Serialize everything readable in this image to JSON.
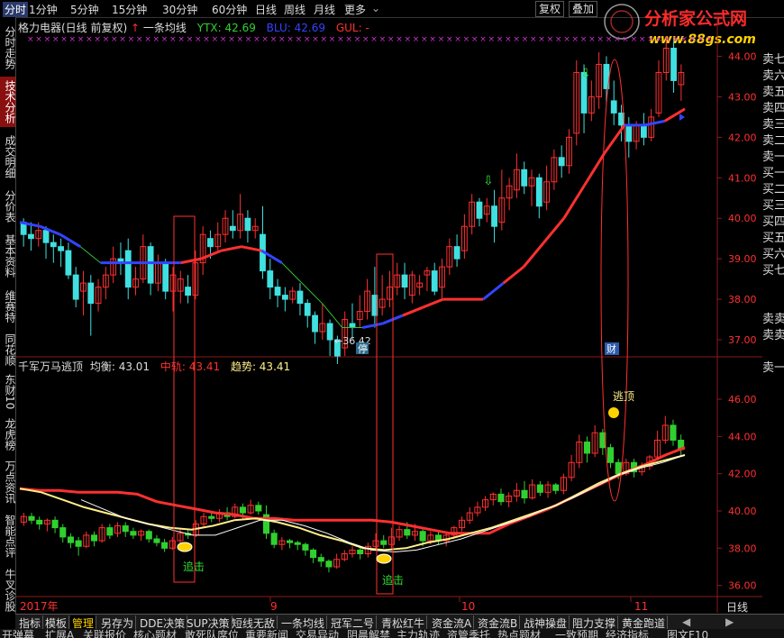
{
  "topbar": {
    "items": [
      "分时",
      "1分钟",
      "5分钟",
      "15分钟",
      "30分钟",
      "60分钟",
      "日线",
      "周线",
      "月线",
      "更多"
    ],
    "restore_btn": "复权",
    "overlay_btn": "叠加"
  },
  "brand": {
    "name": "分析家公式网",
    "url": "www.88gs.com"
  },
  "left_nav": [
    "分时走势",
    "技术分析",
    "成交明细",
    "分价表",
    "基本资料",
    "维赛特",
    "同花顺",
    "东财10",
    "龙虎榜",
    "万点资讯",
    "智能点评",
    "牛叉诊股"
  ],
  "right_nav": [
    "卖七",
    "卖六",
    "卖五",
    "卖四",
    "卖三",
    "卖二",
    "卖一",
    "买一",
    "买二",
    "买三",
    "买四",
    "买五",
    "买六",
    "买七",
    "卖卖",
    "卖卖",
    "卖一"
  ],
  "info_top": {
    "stock": "格力电器(日线 前复权)",
    "indicator": "一条均线",
    "ytx": "YTX: 42.69",
    "blu": "BLU: 42.69",
    "gul": "GUL: -"
  },
  "info_bottom": {
    "indicator": "千军万马逃顶",
    "balance": "均衡: 43.01",
    "middle": "中轨: 43.41",
    "trend": "趋势: 43.41"
  },
  "annotations": {
    "low": "←36.42",
    "stop": "停",
    "cai": "财",
    "escape": "逃顶",
    "chase1": "追击",
    "chase2": "追击"
  },
  "x_labels": [
    "2017年",
    "9",
    "10",
    "11",
    "日线"
  ],
  "bottom_tabs": [
    "指标",
    "模板",
    "管理",
    "另存为",
    "DDE决策",
    "SUP决策",
    "短线无敌",
    "一条均线",
    "冠军二号",
    "青松红牛",
    "资金流A",
    "资金流B",
    "战神操盘",
    "阻力支撑",
    "黄金跑道"
  ],
  "bottom_row2": [
    "开弹幕",
    "扩展A",
    "关联报价",
    "核心题材",
    "敢死队席位",
    "重要新闻",
    "交易异动",
    "阴晨解禁",
    "主力轨迹",
    "资管季托",
    "热点题材",
    "一致预期",
    "经济指标",
    "图文F10"
  ],
  "colors": {
    "up": "#ff3030",
    "down": "#40e0e0",
    "down_lower": "#30d030",
    "blue_line": "#3344ff",
    "green_line": "#33c033",
    "yellow": "#ffee88",
    "white": "#ffffff",
    "grid": "#8a1a1a",
    "axis_text": "#ff3030"
  },
  "chart_data": [
    {
      "type": "candlestick",
      "ylim": [
        36.6,
        44.5
      ],
      "yticks": [
        37.0,
        38.0,
        39.0,
        40.0,
        41.0,
        42.0,
        43.0,
        44.0
      ],
      "candles": [
        [
          39.9,
          39.6,
          40.0,
          39.3
        ],
        [
          39.6,
          39.5,
          39.9,
          39.2
        ],
        [
          39.5,
          39.7,
          39.9,
          39.3
        ],
        [
          39.7,
          39.4,
          39.8,
          39.0
        ],
        [
          39.4,
          39.3,
          39.6,
          38.9
        ],
        [
          39.3,
          39.2,
          39.5,
          38.8
        ],
        [
          39.2,
          38.6,
          39.4,
          38.5
        ],
        [
          38.6,
          38.0,
          38.8,
          37.8
        ],
        [
          38.2,
          38.4,
          38.7,
          37.6
        ],
        [
          38.4,
          37.9,
          38.6,
          37.1
        ],
        [
          37.9,
          38.3,
          38.5,
          37.7
        ],
        [
          38.3,
          38.6,
          38.8,
          38.0
        ],
        [
          38.6,
          39.0,
          39.3,
          38.4
        ],
        [
          39.0,
          38.9,
          39.4,
          38.6
        ],
        [
          39.2,
          38.3,
          39.5,
          38.0
        ],
        [
          38.3,
          38.5,
          38.8,
          38.1
        ],
        [
          38.5,
          39.3,
          39.6,
          38.4
        ],
        [
          39.3,
          38.4,
          39.4,
          38.1
        ],
        [
          38.4,
          38.9,
          39.1,
          38.2
        ],
        [
          38.9,
          38.2,
          39.0,
          38.0
        ],
        [
          38.2,
          38.6,
          38.8,
          37.7
        ],
        [
          38.2,
          38.5,
          38.7,
          37.9
        ],
        [
          38.3,
          38.1,
          38.6,
          37.9
        ],
        [
          38.1,
          38.9,
          39.2,
          38.0
        ],
        [
          38.9,
          39.6,
          39.8,
          38.6
        ],
        [
          39.5,
          39.3,
          39.7,
          39.0
        ],
        [
          39.3,
          39.6,
          39.9,
          39.2
        ],
        [
          39.6,
          40.0,
          40.2,
          39.4
        ],
        [
          39.8,
          39.7,
          40.2,
          39.5
        ],
        [
          39.7,
          40.1,
          40.6,
          39.5
        ],
        [
          40.0,
          39.7,
          40.2,
          39.4
        ],
        [
          39.7,
          39.8,
          40.0,
          39.5
        ],
        [
          39.6,
          38.7,
          40.3,
          38.5
        ],
        [
          38.7,
          38.3,
          39.0,
          38.0
        ],
        [
          38.3,
          38.1,
          38.5,
          37.8
        ],
        [
          38.1,
          38.0,
          38.3,
          37.7
        ],
        [
          38.0,
          38.2,
          38.3,
          37.9
        ],
        [
          38.2,
          37.9,
          38.4,
          37.6
        ],
        [
          37.9,
          37.6,
          38.0,
          37.3
        ],
        [
          37.6,
          37.2,
          37.7,
          36.9
        ],
        [
          37.2,
          37.4,
          37.9,
          37.0
        ],
        [
          37.4,
          37.0,
          37.5,
          36.6
        ],
        [
          37.0,
          36.6,
          37.1,
          36.4
        ],
        [
          36.8,
          37.5,
          37.7,
          36.6
        ],
        [
          37.4,
          37.3,
          37.9,
          37.0
        ],
        [
          37.5,
          37.7,
          38.1,
          37.3
        ],
        [
          37.7,
          38.2,
          38.5,
          37.5
        ],
        [
          38.1,
          37.6,
          38.8,
          37.3
        ],
        [
          37.8,
          38.0,
          38.6,
          37.6
        ],
        [
          38.0,
          38.3,
          38.7,
          37.8
        ],
        [
          38.3,
          38.6,
          38.9,
          38.1
        ],
        [
          38.6,
          38.3,
          38.9,
          38.0
        ],
        [
          38.1,
          38.6,
          38.7,
          37.9
        ],
        [
          38.3,
          38.4,
          38.6,
          38.1
        ],
        [
          38.6,
          38.7,
          38.8,
          38.2
        ],
        [
          38.7,
          38.2,
          38.9,
          38.1
        ],
        [
          38.3,
          38.8,
          39.0,
          38.0
        ],
        [
          38.8,
          39.3,
          39.5,
          38.6
        ],
        [
          39.3,
          39.0,
          39.6,
          38.8
        ],
        [
          39.2,
          39.8,
          40.1,
          39.0
        ],
        [
          39.8,
          40.4,
          40.6,
          39.6
        ],
        [
          40.4,
          40.0,
          40.5,
          39.8
        ],
        [
          40.1,
          40.3,
          40.5,
          39.9
        ],
        [
          40.3,
          39.8,
          40.7,
          39.4
        ],
        [
          39.9,
          40.5,
          41.2,
          39.7
        ],
        [
          40.5,
          40.8,
          41.0,
          40.2
        ],
        [
          40.7,
          41.2,
          41.6,
          40.5
        ],
        [
          41.2,
          40.8,
          41.4,
          40.6
        ],
        [
          40.8,
          41.0,
          41.2,
          40.3
        ],
        [
          41.0,
          40.3,
          41.1,
          40.0
        ],
        [
          40.4,
          40.9,
          41.3,
          40.2
        ],
        [
          40.9,
          41.5,
          41.7,
          40.7
        ],
        [
          41.5,
          41.3,
          41.8,
          41.0
        ],
        [
          41.3,
          42.0,
          42.2,
          41.1
        ],
        [
          42.1,
          43.6,
          43.9,
          41.8
        ],
        [
          43.6,
          42.6,
          43.8,
          42.1
        ],
        [
          42.6,
          43.0,
          43.4,
          42.4
        ],
        [
          43.0,
          43.8,
          44.1,
          42.7
        ],
        [
          43.8,
          43.2,
          44.0,
          42.8
        ],
        [
          42.9,
          42.6,
          43.4,
          42.3
        ],
        [
          42.6,
          42.3,
          42.8,
          41.9
        ],
        [
          42.3,
          41.9,
          42.5,
          41.5
        ],
        [
          41.9,
          42.3,
          42.4,
          41.7
        ],
        [
          42.3,
          42.0,
          42.6,
          41.8
        ],
        [
          42.0,
          42.5,
          42.7,
          41.9
        ],
        [
          42.6,
          43.6,
          43.9,
          42.5
        ],
        [
          43.6,
          44.2,
          44.5,
          43.4
        ],
        [
          44.2,
          43.4,
          44.4,
          43.1
        ],
        [
          43.3,
          43.6,
          43.8,
          42.9
        ]
      ],
      "ytx_line_samples": [
        39.9,
        39.8,
        39.6,
        39.3,
        38.9,
        38.9,
        38.9,
        38.9,
        38.9,
        39.0,
        39.2,
        39.3,
        39.2,
        38.9,
        38.4,
        37.9,
        37.3,
        37.3,
        37.4,
        37.6,
        37.8,
        38.0,
        38.0,
        38.0,
        38.4,
        38.8,
        39.4,
        40.0,
        40.8,
        41.6,
        42.3,
        42.3,
        42.4,
        42.7
      ]
    },
    {
      "type": "candlestick",
      "ylim": [
        35.5,
        47.5
      ],
      "yticks": [
        36.0,
        38.0,
        40.0,
        42.0,
        44.0,
        46.0
      ],
      "candles": [
        [
          39.4,
          39.7,
          39.9,
          39.2
        ],
        [
          39.7,
          39.5,
          39.9,
          39.3
        ],
        [
          39.5,
          39.3,
          39.7,
          39.0
        ],
        [
          39.3,
          39.5,
          39.6,
          38.9
        ],
        [
          39.5,
          39.1,
          39.7,
          38.8
        ],
        [
          39.1,
          38.6,
          39.3,
          38.3
        ],
        [
          38.6,
          38.3,
          38.8,
          38.0
        ],
        [
          38.4,
          38.1,
          38.6,
          37.6
        ],
        [
          38.1,
          38.7,
          38.9,
          38.0
        ],
        [
          38.7,
          38.4,
          38.9,
          38.1
        ],
        [
          38.4,
          39.1,
          39.3,
          38.3
        ],
        [
          39.1,
          38.7,
          39.3,
          38.5
        ],
        [
          38.8,
          39.2,
          39.4,
          38.6
        ],
        [
          39.2,
          38.9,
          39.4,
          38.6
        ],
        [
          38.9,
          38.7,
          39.1,
          38.5
        ],
        [
          38.7,
          38.9,
          39.0,
          38.4
        ],
        [
          38.9,
          38.5,
          39.0,
          38.3
        ],
        [
          38.5,
          38.3,
          38.7,
          38.1
        ],
        [
          38.3,
          38.0,
          38.5,
          37.8
        ],
        [
          38.0,
          38.4,
          38.6,
          37.9
        ],
        [
          38.4,
          38.8,
          39.0,
          38.2
        ],
        [
          38.8,
          38.7,
          39.0,
          38.5
        ],
        [
          38.7,
          39.3,
          39.5,
          38.6
        ],
        [
          39.3,
          39.7,
          39.9,
          39.1
        ],
        [
          39.7,
          39.6,
          40.0,
          39.4
        ],
        [
          39.6,
          39.9,
          40.1,
          39.4
        ],
        [
          39.9,
          39.7,
          40.2,
          39.5
        ],
        [
          39.7,
          40.2,
          40.4,
          39.6
        ],
        [
          40.2,
          39.9,
          40.4,
          39.6
        ],
        [
          39.9,
          40.3,
          40.6,
          39.8
        ],
        [
          40.3,
          40.0,
          40.5,
          39.8
        ],
        [
          39.8,
          38.8,
          40.3,
          38.5
        ],
        [
          38.8,
          38.2,
          39.0,
          38.0
        ],
        [
          38.2,
          38.4,
          38.6,
          37.9
        ],
        [
          38.4,
          38.3,
          38.5,
          38.0
        ],
        [
          38.3,
          38.2,
          38.4,
          37.9
        ],
        [
          38.2,
          37.9,
          38.3,
          37.6
        ],
        [
          37.9,
          37.5,
          38.0,
          37.2
        ],
        [
          37.5,
          37.3,
          37.7,
          37.0
        ],
        [
          37.3,
          37.0,
          37.4,
          36.7
        ],
        [
          37.0,
          37.4,
          37.7,
          36.9
        ],
        [
          37.4,
          37.7,
          37.9,
          37.3
        ],
        [
          37.7,
          37.9,
          38.1,
          37.5
        ],
        [
          37.9,
          37.7,
          38.1,
          37.4
        ],
        [
          37.7,
          38.1,
          38.3,
          37.5
        ],
        [
          38.1,
          38.4,
          38.8,
          37.9
        ],
        [
          38.4,
          38.2,
          38.7,
          38.0
        ],
        [
          38.2,
          38.6,
          39.1,
          38.0
        ],
        [
          38.6,
          39.0,
          39.2,
          38.4
        ],
        [
          39.0,
          38.7,
          39.4,
          38.5
        ],
        [
          38.7,
          38.9,
          39.3,
          38.4
        ],
        [
          38.9,
          38.4,
          39.0,
          38.1
        ],
        [
          38.4,
          38.7,
          38.9,
          38.2
        ],
        [
          38.7,
          38.4,
          38.9,
          38.2
        ],
        [
          38.4,
          38.7,
          38.9,
          38.1
        ],
        [
          38.7,
          39.1,
          39.2,
          38.5
        ],
        [
          39.1,
          39.5,
          39.7,
          38.9
        ],
        [
          39.5,
          39.9,
          40.2,
          39.3
        ],
        [
          39.9,
          40.2,
          40.5,
          39.7
        ],
        [
          40.2,
          40.6,
          40.8,
          40.0
        ],
        [
          40.6,
          40.9,
          41.0,
          40.3
        ],
        [
          40.9,
          40.5,
          41.2,
          40.3
        ],
        [
          40.5,
          40.8,
          41.0,
          40.2
        ],
        [
          40.8,
          41.1,
          41.5,
          40.5
        ],
        [
          41.1,
          40.7,
          41.6,
          40.4
        ],
        [
          40.7,
          41.4,
          41.7,
          40.6
        ],
        [
          41.4,
          41.0,
          41.6,
          40.8
        ],
        [
          41.0,
          41.4,
          41.6,
          40.7
        ],
        [
          41.4,
          41.1,
          41.5,
          40.9
        ],
        [
          41.1,
          41.8,
          42.0,
          40.9
        ],
        [
          41.8,
          42.6,
          43.0,
          41.6
        ],
        [
          42.6,
          43.7,
          44.1,
          42.3
        ],
        [
          43.7,
          43.1,
          44.0,
          42.6
        ],
        [
          43.1,
          44.2,
          44.6,
          42.9
        ],
        [
          44.2,
          43.4,
          44.4,
          43.0
        ],
        [
          43.4,
          42.6,
          43.6,
          42.3
        ],
        [
          42.6,
          42.0,
          42.8,
          41.7
        ],
        [
          42.0,
          42.6,
          42.8,
          41.9
        ],
        [
          42.6,
          42.1,
          42.8,
          41.8
        ],
        [
          42.1,
          42.4,
          42.6,
          41.9
        ],
        [
          42.4,
          42.9,
          43.0,
          42.2
        ],
        [
          42.9,
          43.8,
          44.3,
          42.7
        ],
        [
          43.8,
          44.6,
          45.1,
          43.6
        ],
        [
          44.6,
          43.8,
          44.9,
          43.5
        ],
        [
          43.8,
          43.3,
          44.1,
          42.9
        ]
      ],
      "red_line_samples": [
        41.2,
        41.1,
        41.1,
        41.0,
        41.0,
        41.0,
        40.9,
        40.5,
        40.3,
        40.1,
        39.9,
        39.8,
        39.6,
        39.6,
        39.5,
        39.5,
        39.5,
        39.5,
        39.5,
        39.4,
        39.2,
        39.0,
        38.8,
        38.8,
        38.8,
        39.3,
        39.7,
        40.1,
        40.6,
        41.1,
        41.6,
        42.1,
        42.5,
        43.0,
        43.4
      ],
      "yellow_line_samples": [
        41.2,
        41.0,
        40.6,
        40.2,
        39.9,
        39.6,
        39.3,
        39.1,
        39.0,
        39.2,
        39.5,
        39.6,
        39.4,
        39.1,
        38.7,
        38.4,
        38.0,
        37.9,
        38.0,
        38.3,
        38.5,
        38.8,
        39.1,
        39.5,
        39.9,
        40.3,
        40.9,
        41.5,
        42.0,
        42.4,
        42.7,
        43.0
      ],
      "white_line_samples": [
        40.6,
        40.1,
        39.6,
        39.3,
        39.0,
        38.7,
        38.7,
        39.1,
        39.5,
        39.5,
        39.2,
        38.8,
        38.3,
        37.9,
        37.8,
        37.9,
        38.2,
        38.5,
        38.9,
        39.3,
        39.7,
        40.2,
        40.7,
        41.3,
        41.9,
        42.3,
        42.6,
        43.0
      ]
    }
  ]
}
